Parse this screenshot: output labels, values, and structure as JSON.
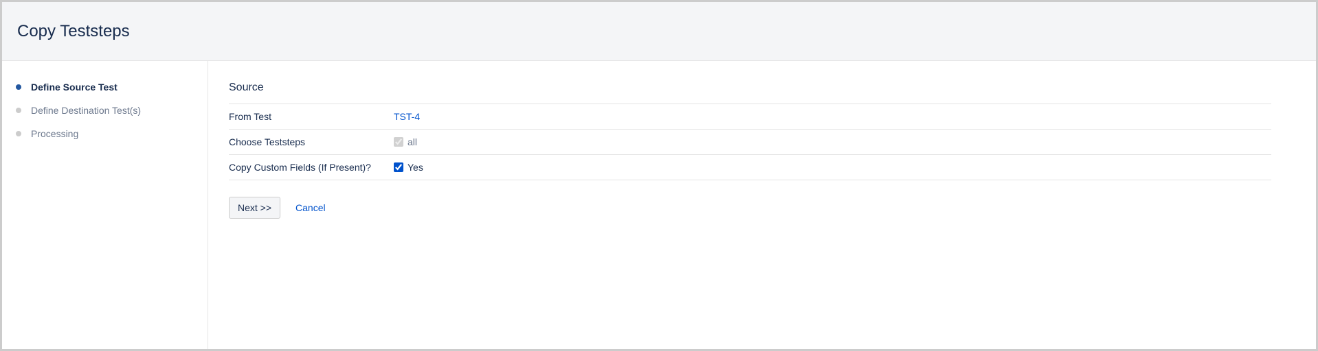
{
  "header": {
    "title": "Copy Teststeps"
  },
  "sidebar": {
    "steps": [
      {
        "label": "Define Source Test"
      },
      {
        "label": "Define Destination Test(s)"
      },
      {
        "label": "Processing"
      }
    ]
  },
  "main": {
    "section_title": "Source",
    "rows": {
      "from_test": {
        "label": "From Test",
        "value": "TST-4"
      },
      "choose_teststeps": {
        "label": "Choose Teststeps",
        "option": "all"
      },
      "copy_custom_fields": {
        "label": "Copy Custom Fields (If Present)?",
        "option": "Yes"
      }
    },
    "actions": {
      "next": "Next >>",
      "cancel": "Cancel"
    }
  }
}
